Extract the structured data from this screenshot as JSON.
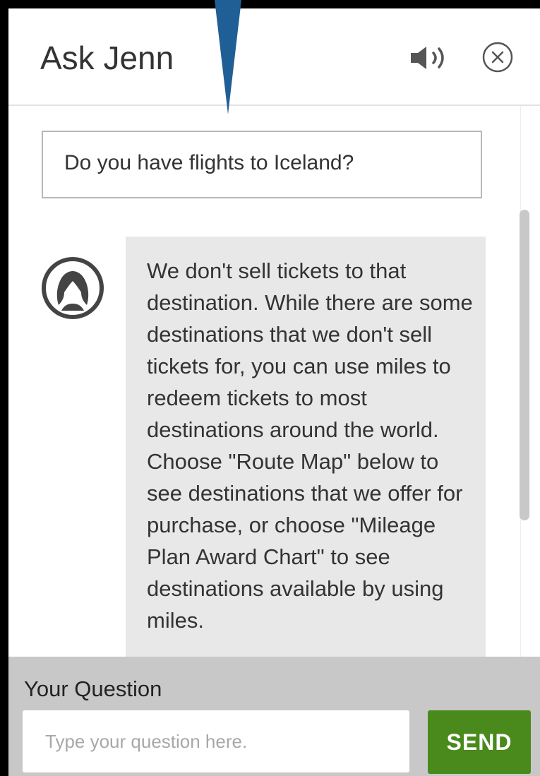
{
  "header": {
    "title": "Ask Jenn",
    "speaker_icon": "speaker-icon",
    "close_icon": "close-icon"
  },
  "conversation": {
    "user_message": "Do you have flights to Iceland?",
    "avatar_icon": "agent-avatar-icon",
    "bot_message": "We don't sell tickets to that destination. While there are some destinations that we don't sell tickets for, you can use miles to redeem tickets to most destinations around the world. Choose \"Route Map\" below to see destinations that we offer for purchase, or choose \"Mileage Plan Award Chart\" to see destinations available by using miles."
  },
  "footer": {
    "label": "Your Question",
    "input_placeholder": "Type your question here.",
    "input_value": "",
    "send_label": "SEND"
  },
  "colors": {
    "pointer": "#1f5f95",
    "send_button": "#4a8a1c",
    "bubble": "#e8e8e8",
    "footer": "#c8c8c8"
  }
}
